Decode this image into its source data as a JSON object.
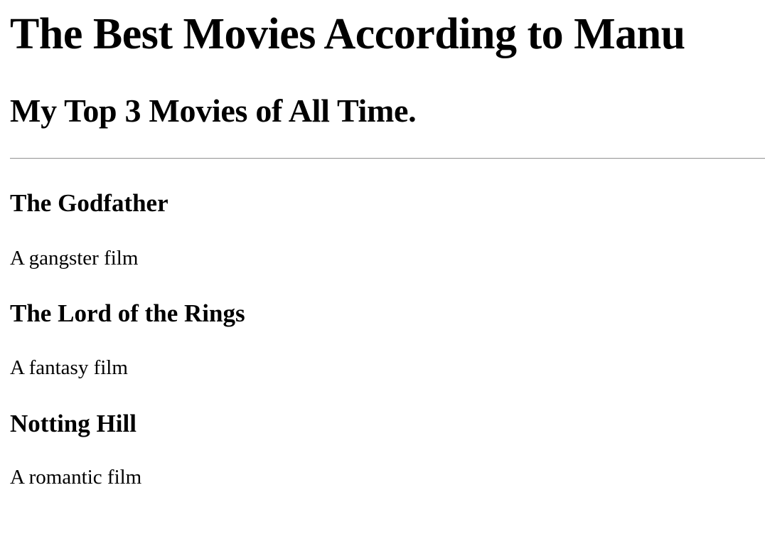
{
  "page": {
    "title": "The Best Movies According to Manu",
    "subtitle": "My Top 3 Movies of All Time."
  },
  "movies": [
    {
      "title": "The Godfather",
      "description": "A gangster film"
    },
    {
      "title": "The Lord of the Rings",
      "description": "A fantasy film"
    },
    {
      "title": "Notting Hill",
      "description": "A romantic film"
    }
  ]
}
